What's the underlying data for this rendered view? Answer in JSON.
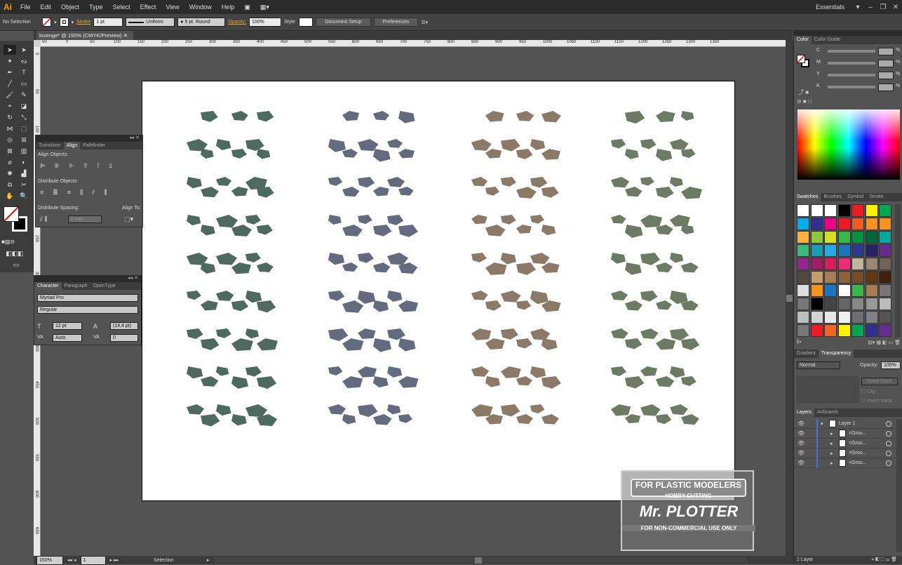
{
  "app": {
    "logo": "Ai",
    "workspace": "Essentials"
  },
  "menu": [
    "File",
    "Edit",
    "Object",
    "Type",
    "Select",
    "Effect",
    "View",
    "Window",
    "Help"
  ],
  "control": {
    "selection": "No Selection",
    "stroke_label": "Stroke",
    "stroke_weight": "1 pt",
    "profile": "Uniform",
    "brush": "5 pt. Round",
    "opacity_label": "Opacity:",
    "opacity": "100%",
    "style_label": "Style:",
    "doc_setup": "Document Setup",
    "preferences": "Preferences"
  },
  "document": {
    "tab": "lozenge* @ 150% (CMYK/Preview)",
    "zoom": "150%",
    "artboard_num": "1",
    "status": "Selection"
  },
  "ruler_h": [
    "50",
    "0",
    "50",
    "100",
    "150",
    "200",
    "250",
    "300",
    "350",
    "400",
    "450",
    "500",
    "550",
    "600",
    "650",
    "700",
    "750",
    "800",
    "850",
    "900",
    "950",
    "1000",
    "1050",
    "1100",
    "1150",
    "1200",
    "1250",
    "1300",
    "1350"
  ],
  "ruler_v": [
    "0",
    "50",
    "100",
    "150",
    "200",
    "250",
    "300",
    "350",
    "400",
    "450",
    "500",
    "550",
    "600",
    "650"
  ],
  "align_panel": {
    "tabs": [
      "Transform",
      "Align",
      "Pathfinder"
    ],
    "align_objects": "Align Objects:",
    "distribute_objects": "Distribute Objects:",
    "distribute_spacing": "Distribute Spacing:",
    "align_to": "Align To:",
    "spacing_value": "0 mm"
  },
  "character_panel": {
    "tabs": [
      "Character",
      "Paragraph",
      "OpenType"
    ],
    "font": "Myriad Pro",
    "style": "Regular",
    "size": "12 pt",
    "leading": "(14,4 pt)",
    "kerning": "Auto",
    "tracking": "0"
  },
  "color_panel": {
    "tabs": [
      "Color",
      "Color Guide"
    ],
    "channels": [
      "C",
      "M",
      "Y",
      "K"
    ],
    "unit": "%"
  },
  "swatches_panel": {
    "tabs": [
      "Swatches",
      "Brushes",
      "Symbol",
      "Stroke"
    ],
    "rows": [
      [
        "#ffffff",
        "#ffffff",
        "#ffffff",
        "#000000",
        "#ed1c24",
        "#fff200",
        "#00a651"
      ],
      [
        "#00aeef",
        "#2e3192",
        "#ec008c",
        "#ed1c24",
        "#f15a24",
        "#f7931e",
        "#f7941d"
      ],
      [
        "#fbb040",
        "#8dc63f",
        "#d7df23",
        "#39b54a",
        "#009444",
        "#006838",
        "#00a99d"
      ],
      [
        "#3cb878",
        "#1b9bb5",
        "#27aae1",
        "#1c75bc",
        "#2b3990",
        "#262262",
        "#662d91"
      ],
      [
        "#92278f",
        "#9e1f63",
        "#da1c5c",
        "#ee2a7b",
        "#c2b59b",
        "#998675",
        "#736357"
      ],
      [
        "#534741",
        "#c69c6d",
        "#a67c52",
        "#8c6239",
        "#754c24",
        "#603913",
        "#42210b"
      ],
      [
        "#dddddd",
        "#f7941d",
        "#1b75bc",
        "#ffffff",
        "#39b54a",
        "#a67c52",
        "#777777"
      ],
      [
        "#777777",
        "#000000",
        "#444444",
        "#666666",
        "#888888",
        "#999999",
        "#bbbbbb"
      ],
      [
        "#bcbec0",
        "#d1d3d4",
        "#e6e7e8",
        "#f1f2f2",
        "#6d6e71",
        "#808285",
        "#555555"
      ],
      [
        "#777777",
        "#ed1c24",
        "#f26522",
        "#fff200",
        "#00a651",
        "#2e3192",
        "#662d91"
      ]
    ]
  },
  "transparency_panel": {
    "tabs": [
      "Gradient",
      "Transparency"
    ],
    "mode": "Normal",
    "opacity_label": "Opacity:",
    "opacity": "100%",
    "make_mask": "Make Mask",
    "clip": "Clip",
    "invert": "Invert Mask"
  },
  "layers_panel": {
    "tabs": [
      "Layers",
      "Artboards"
    ],
    "layer": "Layer 1",
    "groups": [
      "<Grou...",
      "<Grou...",
      "<Grou...",
      "<Grou..."
    ],
    "footer": "1 Layer"
  },
  "artwork": {
    "colors": [
      "#4e695f",
      "#646b7e",
      "#8c7a68",
      "#6e7b64"
    ]
  },
  "watermark": {
    "line1": "FOR PLASTIC MODELERS",
    "line2": "HOBBY CUTTING",
    "line3": "Mr. PLOTTER",
    "line4": "FOR NON-COMMERCIAL USE ONLY"
  }
}
